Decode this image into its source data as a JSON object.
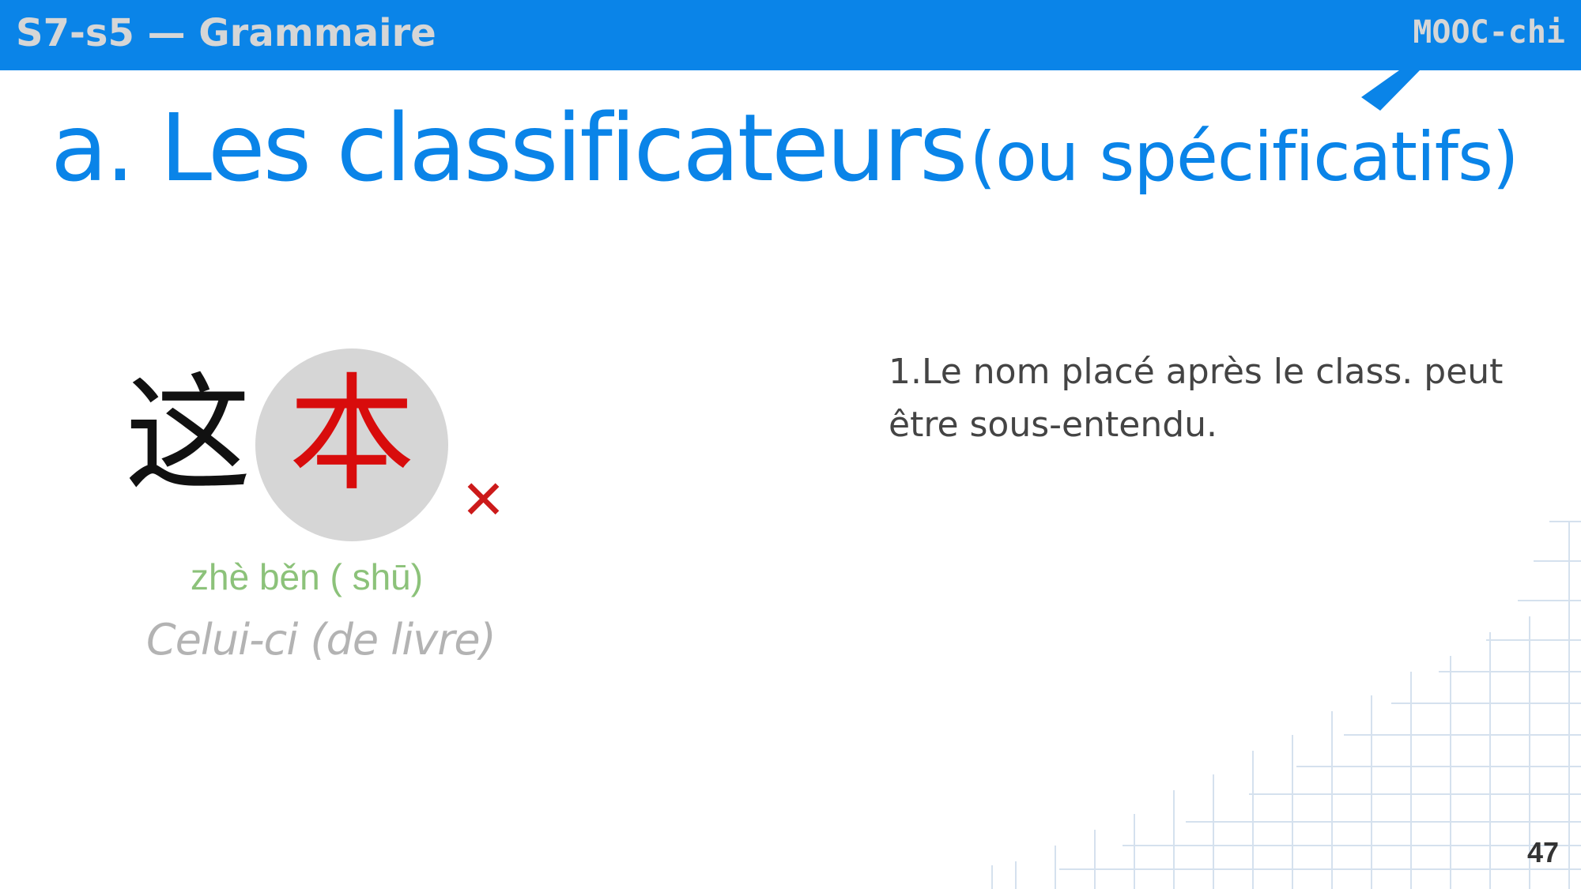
{
  "header": {
    "section": "S7-s5 — Grammaire",
    "brand": "MOOC-chi"
  },
  "title": {
    "main": "a. Les classificateurs",
    "paren": "(ou spécificatifs)"
  },
  "example": {
    "char1": "这",
    "char2": "本",
    "wrong_mark": "✕",
    "pinyin": "zhè běn ( shū)",
    "translation": "Celui-ci (de livre)"
  },
  "rule": {
    "text": "1.Le nom placé après le class. peut être sous-entendu."
  },
  "footer": {
    "page_number": "47"
  },
  "colors": {
    "accent": "#0a84e8",
    "highlight": "#d80c0c",
    "pinyin": "#8cc27a"
  }
}
